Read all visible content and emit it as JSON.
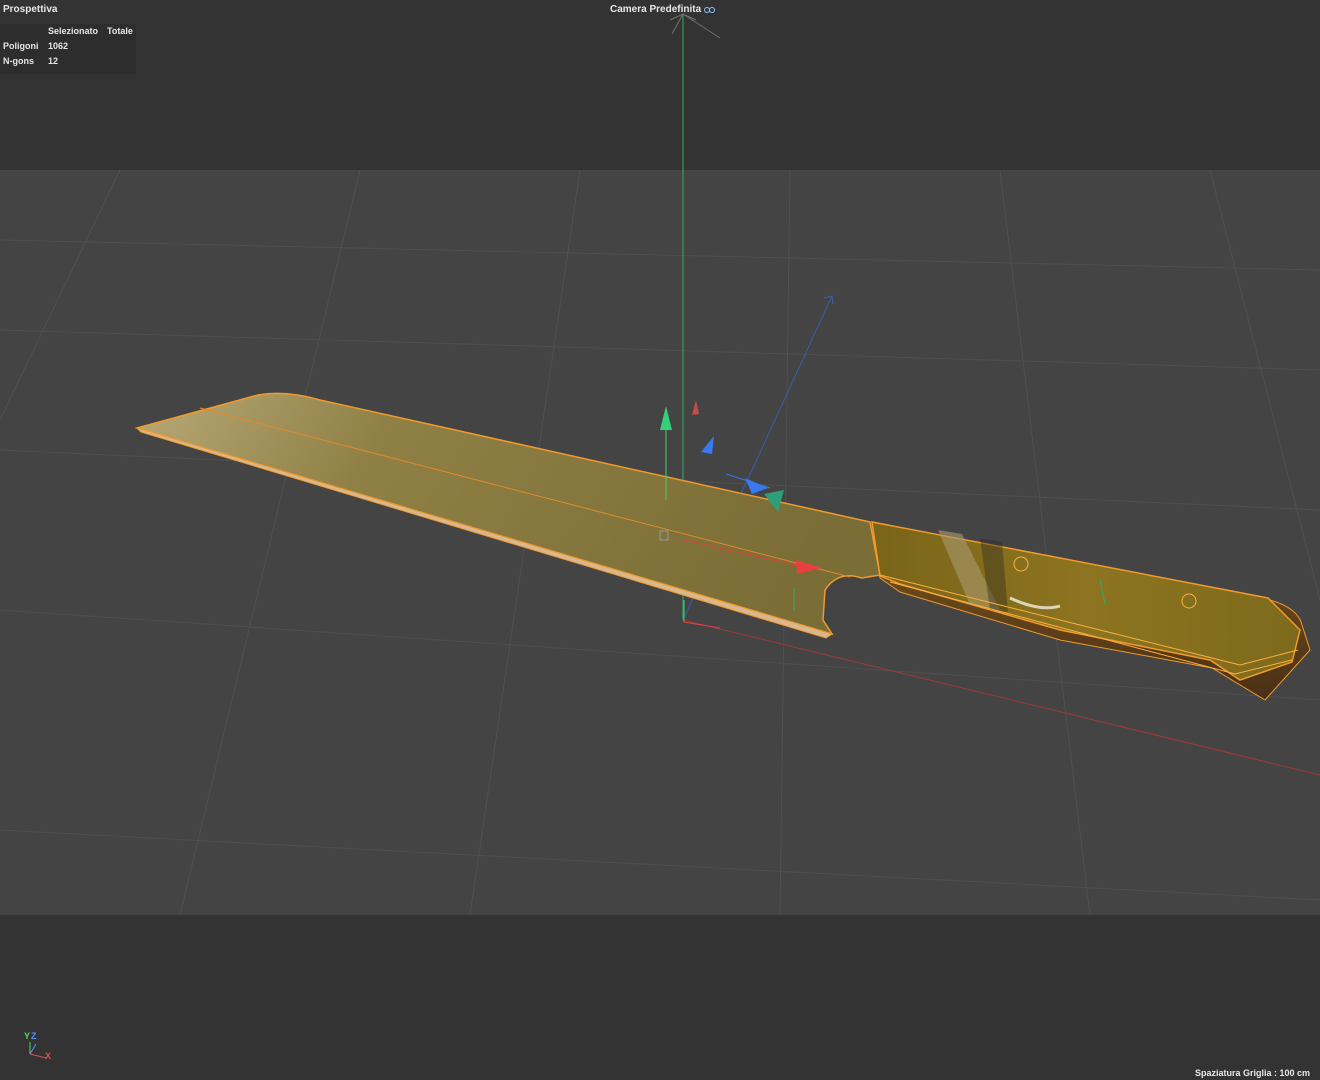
{
  "viewport": {
    "view_name": "Prospettiva",
    "camera_label": "Camera Predefinita",
    "camera_icon": "camera-icon"
  },
  "stats": {
    "headers": [
      "",
      "Selezionato",
      "Totale"
    ],
    "rows": [
      {
        "label": "Poligoni",
        "value": "1062"
      },
      {
        "label": "N-gons",
        "value": "12"
      }
    ]
  },
  "axis_indicator": {
    "y": "Y",
    "z": "Z",
    "x": "X"
  },
  "footer": {
    "grid_spacing": "Spaziatura Griglia : 100 cm"
  },
  "colors": {
    "background": "#3a3a3a",
    "background_top": "#333333",
    "floor_plane": "#444444",
    "selection": "#f09a2c",
    "axis_x": "#e04040",
    "axis_y": "#40d070",
    "axis_z": "#4a7cf0"
  }
}
